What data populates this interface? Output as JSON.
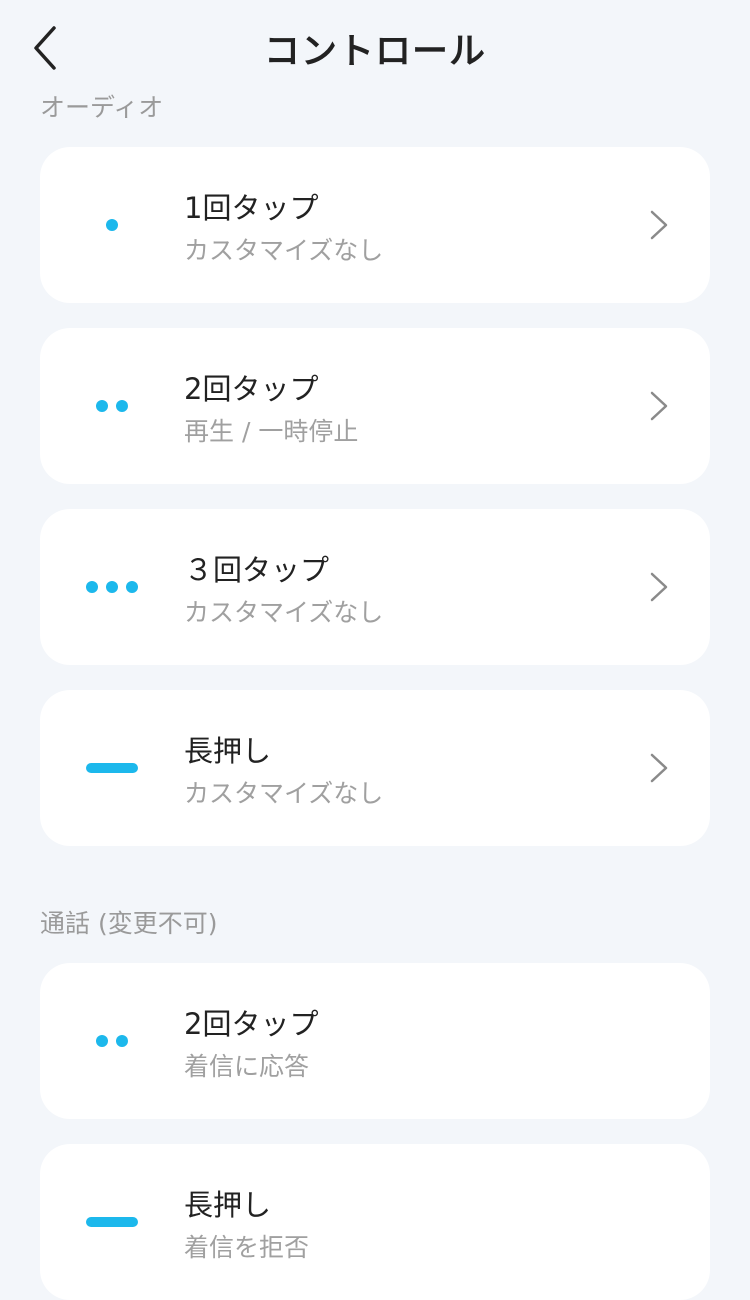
{
  "header": {
    "title": "コントロール"
  },
  "sections": [
    {
      "label": "オーディオ",
      "items": [
        {
          "icon": "single-dot-icon",
          "title": "1回タップ",
          "subtitle": "カスタマイズなし"
        },
        {
          "icon": "double-dot-icon",
          "title": "2回タップ",
          "subtitle": "再生 / 一時停止"
        },
        {
          "icon": "triple-dot-icon",
          "title": "３回タップ",
          "subtitle": "カスタマイズなし"
        },
        {
          "icon": "long-press-dash-icon",
          "title": "長押し",
          "subtitle": "カスタマイズなし"
        }
      ]
    },
    {
      "label": "通話 (変更不可)",
      "items": [
        {
          "icon": "double-dot-icon",
          "title": "2回タップ",
          "subtitle": "着信に応答"
        },
        {
          "icon": "long-press-dash-icon",
          "title": "長押し",
          "subtitle": "着信を拒否"
        }
      ]
    }
  ],
  "colors": {
    "accent": "#1cb8ec",
    "background": "#f3f6fa",
    "card": "#ffffff"
  }
}
